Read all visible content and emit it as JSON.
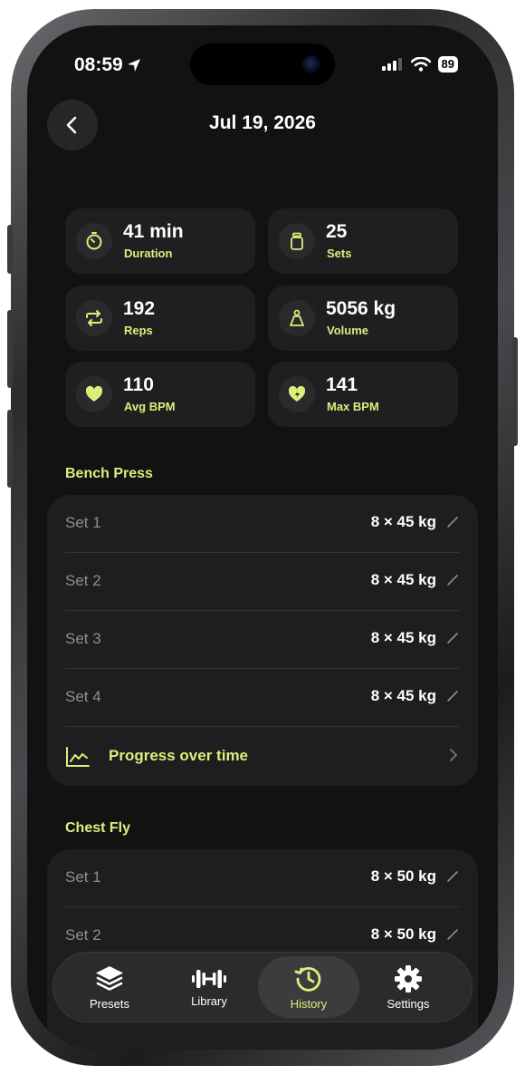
{
  "status_bar": {
    "time": "08:59",
    "battery": "89"
  },
  "header": {
    "title": "Jul 19, 2026"
  },
  "stats": [
    {
      "value": "41 min",
      "label": "Duration",
      "icon": "timer-icon"
    },
    {
      "value": "25",
      "label": "Sets",
      "icon": "jar-icon"
    },
    {
      "value": "192",
      "label": "Reps",
      "icon": "repeat-icon"
    },
    {
      "value": "5056 kg",
      "label": "Volume",
      "icon": "kettlebell-icon"
    },
    {
      "value": "110",
      "label": "Avg BPM",
      "icon": "heart-icon"
    },
    {
      "value": "141",
      "label": "Max BPM",
      "icon": "heart-bolt-icon"
    }
  ],
  "exercises": [
    {
      "name": "Bench Press",
      "sets": [
        {
          "label": "Set 1",
          "value": "8 × 45 kg"
        },
        {
          "label": "Set 2",
          "value": "8 × 45 kg"
        },
        {
          "label": "Set 3",
          "value": "8 × 45 kg"
        },
        {
          "label": "Set 4",
          "value": "8 × 45 kg"
        }
      ],
      "progress_label": "Progress over time"
    },
    {
      "name": "Chest Fly",
      "sets": [
        {
          "label": "Set 1",
          "value": "8 × 50 kg"
        },
        {
          "label": "Set 2",
          "value": "8 × 50 kg"
        }
      ]
    }
  ],
  "tabbar": {
    "tabs": [
      {
        "label": "Presets",
        "icon": "layers-icon"
      },
      {
        "label": "Library",
        "icon": "dumbbell-icon"
      },
      {
        "label": "History",
        "icon": "history-icon",
        "active": true
      },
      {
        "label": "Settings",
        "icon": "gear-icon"
      }
    ]
  },
  "colors": {
    "accent": "#d9f07a",
    "background": "#121212",
    "card": "#1f1f21"
  }
}
